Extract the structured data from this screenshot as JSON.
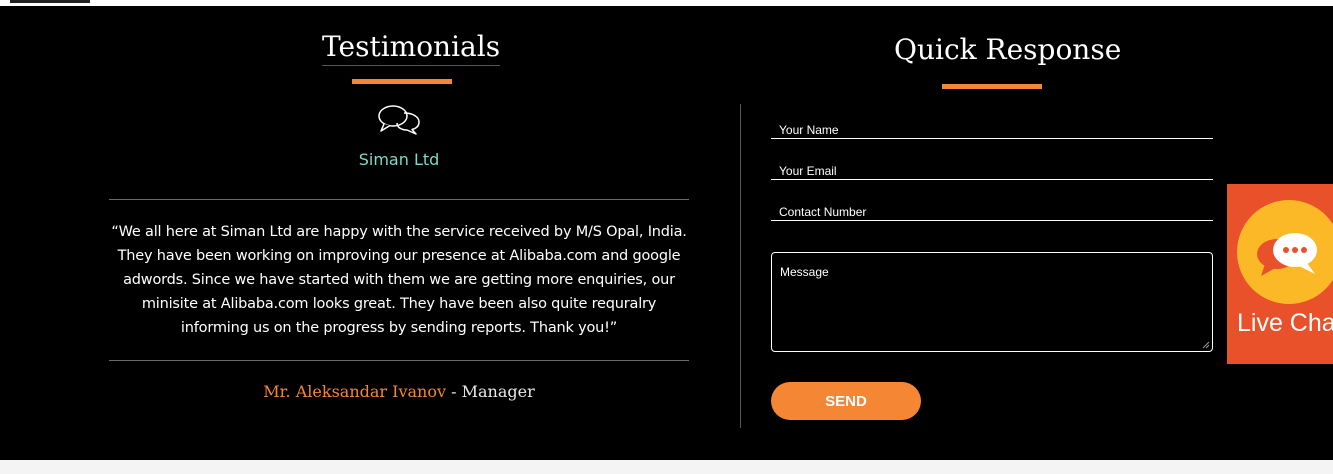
{
  "testimonials": {
    "title": "Testimonials",
    "company": "Siman Ltd",
    "quote": "“We all here at Siman Ltd are happy with the service received by M/S Opal, India. They have been working on improving our presence at Alibaba.com and google adwords. Since we have started with them we are getting more enquiries, our minisite at Alibaba.com looks great. They have been also quite requralry informing us on the progress by sending reports. Thank you!”",
    "author_name": "Mr. Aleksandar Ivanov",
    "author_separator": " - ",
    "author_role": "Manager",
    "icon": "chat-bubbles-icon"
  },
  "quick_response": {
    "title": "Quick Response",
    "name_placeholder": "Your Name",
    "email_placeholder": "Your Email",
    "phone_placeholder": "Contact Number",
    "message_placeholder": "Message",
    "send_label": "SEND"
  },
  "live_chat": {
    "label": "Live Cha",
    "icon": "live-chat-icon"
  },
  "colors": {
    "accent": "#f58634",
    "company": "#7fd8c8",
    "background": "#000000",
    "live_chat_bg": "#e8512a",
    "live_chat_circle": "#fbb927"
  }
}
